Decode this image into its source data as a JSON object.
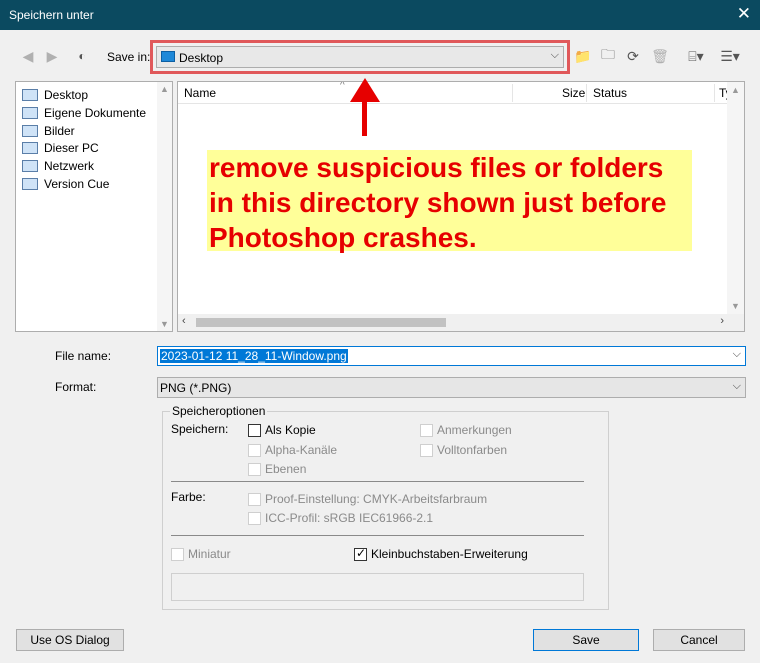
{
  "window": {
    "title": "Speichern unter"
  },
  "toolbar": {
    "save_in_label": "Save in:",
    "save_in_value": "Desktop"
  },
  "places": [
    {
      "label": "Desktop"
    },
    {
      "label": "Eigene Dokumente"
    },
    {
      "label": "Bilder"
    },
    {
      "label": "Dieser PC"
    },
    {
      "label": "Netzwerk"
    },
    {
      "label": "Version Cue"
    }
  ],
  "file_list": {
    "columns": [
      {
        "label": "Name"
      },
      {
        "label": "Size"
      },
      {
        "label": "Status"
      },
      {
        "label": "Type"
      }
    ]
  },
  "annotation": {
    "lines": [
      "remove suspicious files or folders",
      "in this directory shown just before",
      "Photoshop crashes."
    ],
    "highlight_color": "#ffff99",
    "text_color": "#e60000",
    "frame_color": "#e0585a"
  },
  "form": {
    "file_name_label": "File name:",
    "file_name_value": "2023-01-12 11_28_11-Window.png",
    "format_label": "Format:",
    "format_value": "PNG (*.PNG)"
  },
  "options": {
    "group_title": "Speicheroptionen",
    "save_label": "Speichern:",
    "color_label": "Farbe:",
    "as_copy": {
      "label": "Als Kopie",
      "checked": false,
      "enabled": true
    },
    "alpha": {
      "label": "Alpha-Kanäle",
      "checked": false,
      "enabled": false
    },
    "layers": {
      "label": "Ebenen",
      "checked": false,
      "enabled": false
    },
    "notes": {
      "label": "Anmerkungen",
      "checked": false,
      "enabled": false
    },
    "spot": {
      "label": "Volltonfarben",
      "checked": false,
      "enabled": false
    },
    "proof": {
      "label": "Proof-Einstellung: CMYK-Arbeitsfarbraum",
      "checked": false,
      "enabled": false
    },
    "icc": {
      "label": "ICC-Profil: sRGB IEC61966-2.1",
      "checked": false,
      "enabled": false
    },
    "thumbnail": {
      "label": "Miniatur",
      "checked": false,
      "enabled": false
    },
    "lowercase": {
      "label": "Kleinbuchstaben-Erweiterung",
      "checked": true,
      "enabled": true
    }
  },
  "buttons": {
    "os_dialog": "Use OS Dialog",
    "save": "Save",
    "cancel": "Cancel"
  }
}
